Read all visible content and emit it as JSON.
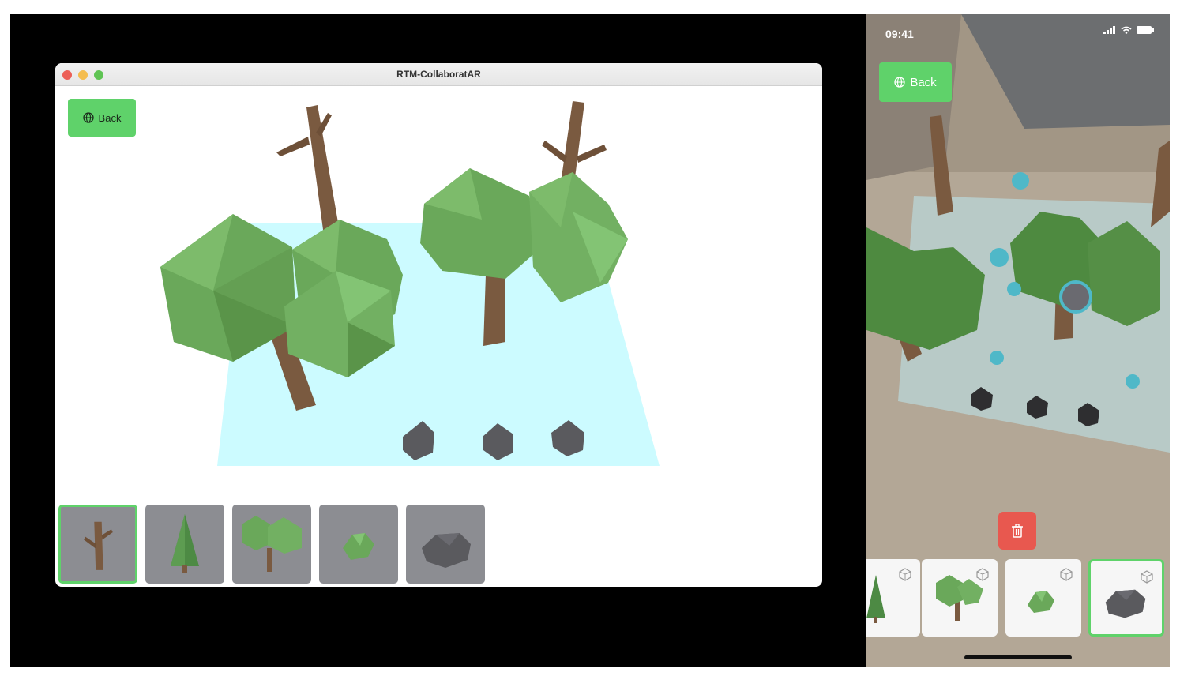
{
  "window": {
    "title": "RTM-CollaboratAR",
    "back_label": "Back",
    "traffic_lights": [
      "#ec5f57",
      "#f4bd4f",
      "#5fc454"
    ]
  },
  "tray": {
    "items": [
      {
        "name": "dead-tree-model",
        "selected": true
      },
      {
        "name": "pine-tree-model",
        "selected": false
      },
      {
        "name": "twin-tree-model",
        "selected": false
      },
      {
        "name": "bush-model",
        "selected": false
      },
      {
        "name": "rock-model",
        "selected": false
      }
    ]
  },
  "phone": {
    "time": "09:41",
    "back_label": "Back",
    "carousel": [
      {
        "name": "pine-tree-model",
        "selected": false
      },
      {
        "name": "twin-tree-model",
        "selected": false
      },
      {
        "name": "bush-model",
        "selected": false
      },
      {
        "name": "rock-model",
        "selected": true
      }
    ]
  },
  "colors": {
    "accent_green": "#5fd26a",
    "plane_cyan": "#ccfbff",
    "foliage": "#6aa85a",
    "trunk": "#7a5a40",
    "rock": "#5a5a5e",
    "trash": "#e8584f"
  }
}
